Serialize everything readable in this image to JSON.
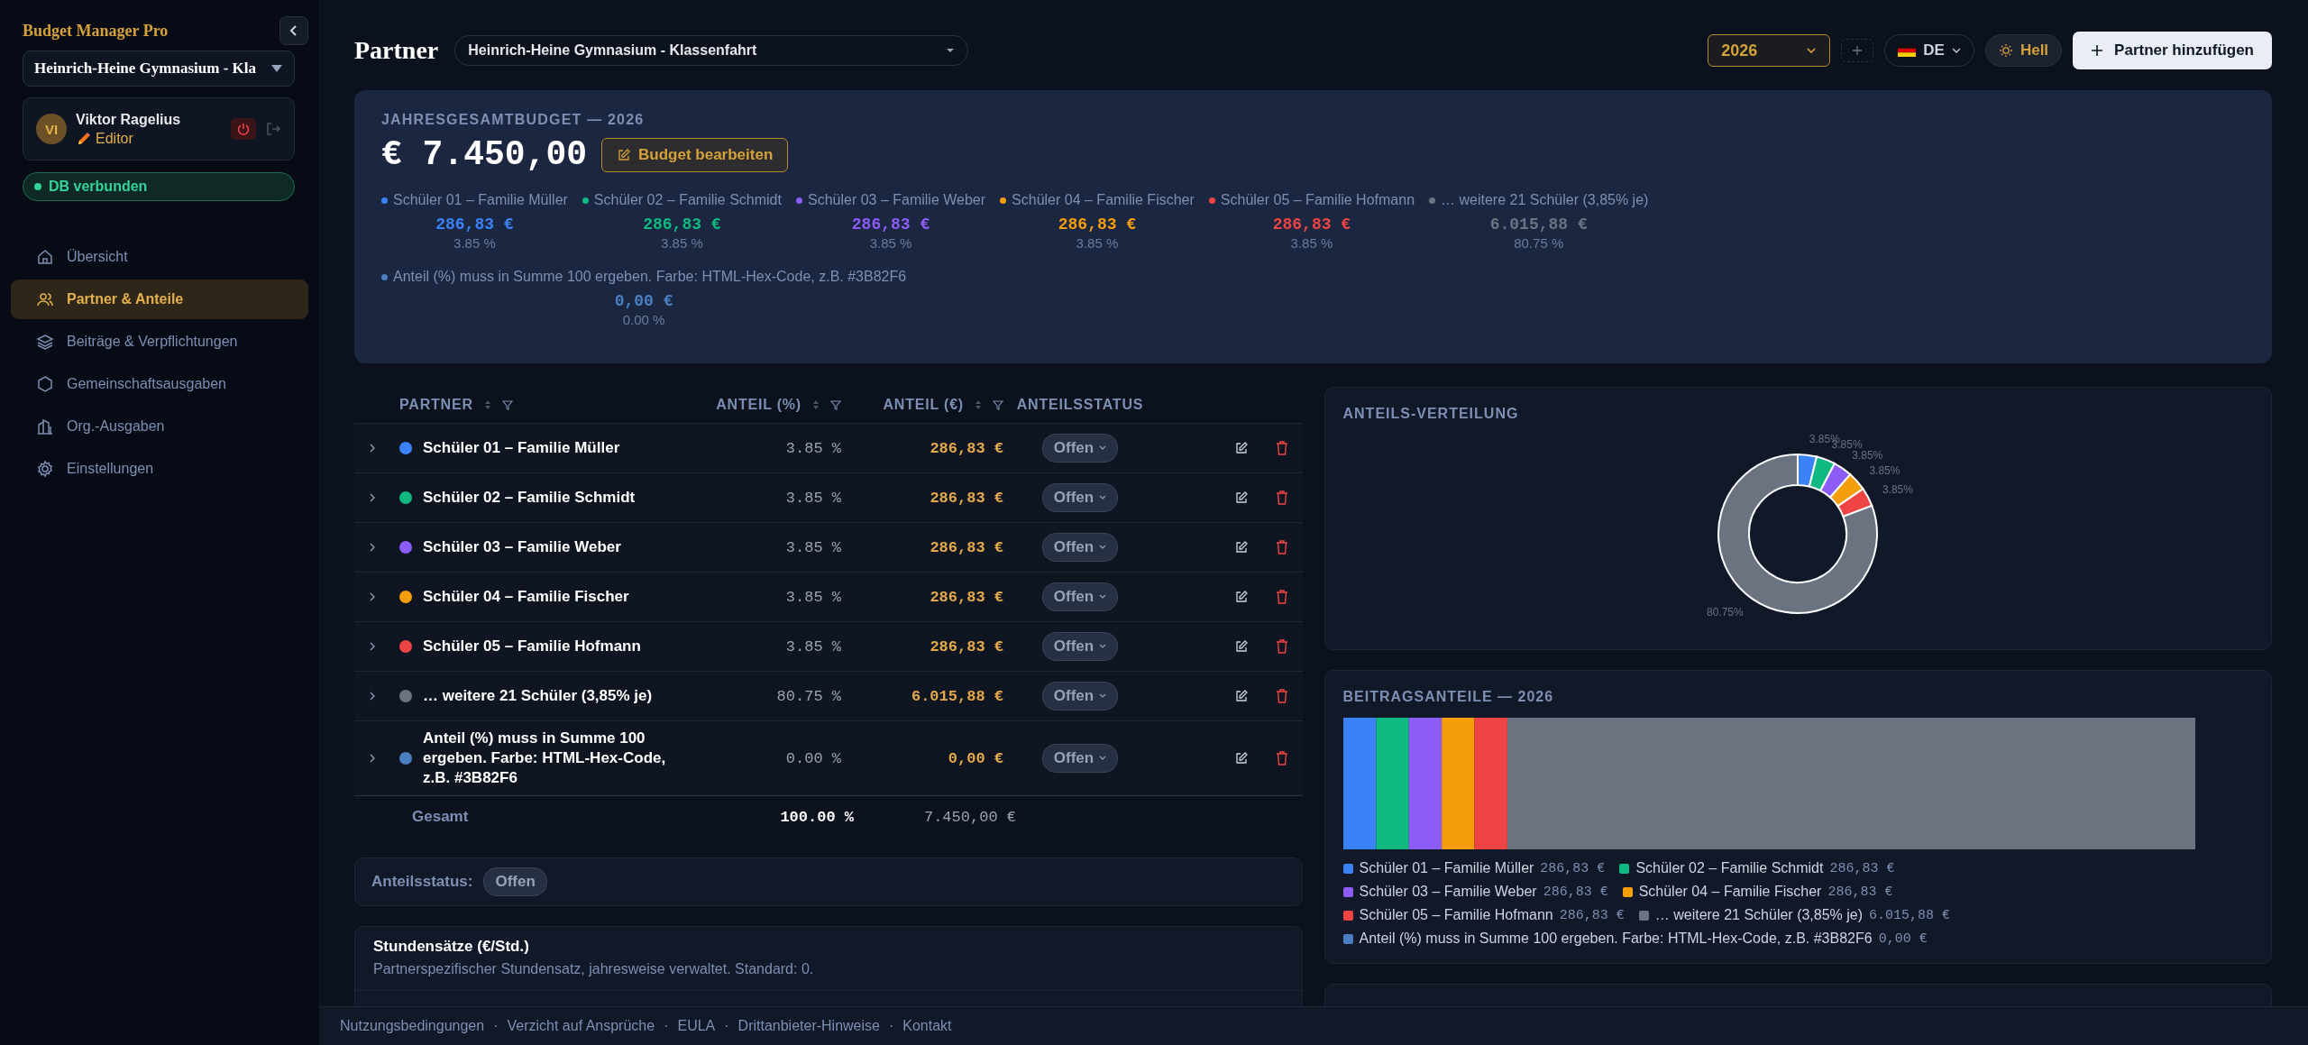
{
  "sidebar": {
    "brand": "Budget Manager Pro",
    "project": "Heinrich-Heine Gymnasium - Kla",
    "user": {
      "initials": "VI",
      "name": "Viktor Ragelius",
      "role": "Editor"
    },
    "db_status": "DB verbunden",
    "nav": [
      {
        "label": "Übersicht",
        "selected": false
      },
      {
        "label": "Partner & Anteile",
        "selected": true
      },
      {
        "label": "Beiträge & Verpflichtungen",
        "selected": false
      },
      {
        "label": "Gemeinschaftsausgaben",
        "selected": false
      },
      {
        "label": "Org.-Ausgaben",
        "selected": false
      },
      {
        "label": "Einstellungen",
        "selected": false
      }
    ]
  },
  "header": {
    "title": "Partner",
    "project": "Heinrich-Heine Gymnasium - Klassenfahrt",
    "year": "2026",
    "language": "DE",
    "theme": "Hell",
    "add_button": "Partner hinzufügen"
  },
  "budget": {
    "label": "JAHRESGESAMTBUDGET — 2026",
    "total": "€ 7.450,00",
    "edit_button": "Budget bearbeiten",
    "shares": [
      {
        "name": "Schüler 01 – Familie Müller",
        "color": "#3b82f6",
        "amount": "286,83 €",
        "percent": "3.85 %"
      },
      {
        "name": "Schüler 02 – Familie Schmidt",
        "color": "#10b981",
        "amount": "286,83 €",
        "percent": "3.85 %"
      },
      {
        "name": "Schüler 03 – Familie Weber",
        "color": "#8b5cf6",
        "amount": "286,83 €",
        "percent": "3.85 %"
      },
      {
        "name": "Schüler 04 – Familie Fischer",
        "color": "#f59e0b",
        "amount": "286,83 €",
        "percent": "3.85 %"
      },
      {
        "name": "Schüler 05 – Familie Hofmann",
        "color": "#ef4444",
        "amount": "286,83 €",
        "percent": "3.85 %"
      },
      {
        "name": "… weitere 21 Schüler (3,85% je)",
        "color": "#6b7280",
        "amount": "6.015,88 €",
        "percent": "80.75 %"
      },
      {
        "name": "Anteil (%) muss in Summe 100 ergeben. Farbe: HTML-Hex-Code, z.B. #3B82F6",
        "color": "#4a7fc1",
        "amount": "0,00 €",
        "percent": "0.00 %"
      }
    ]
  },
  "table": {
    "columns": [
      {
        "label": "PARTNER",
        "sortable": true,
        "filterable": true
      },
      {
        "label": "ANTEIL (%)",
        "sortable": true,
        "filterable": true
      },
      {
        "label": "ANTEIL (€)",
        "sortable": true,
        "filterable": true
      },
      {
        "label": "ANTEILSSTATUS",
        "sortable": false,
        "filterable": false
      }
    ],
    "rows": [
      {
        "name": "Schüler 01 – Familie Müller",
        "color": "#3b82f6",
        "percent": "3.85 %",
        "amount": "286,83 €",
        "status": "Offen"
      },
      {
        "name": "Schüler 02 – Familie Schmidt",
        "color": "#10b981",
        "percent": "3.85 %",
        "amount": "286,83 €",
        "status": "Offen"
      },
      {
        "name": "Schüler 03 – Familie Weber",
        "color": "#8b5cf6",
        "percent": "3.85 %",
        "amount": "286,83 €",
        "status": "Offen"
      },
      {
        "name": "Schüler 04 – Familie Fischer",
        "color": "#f59e0b",
        "percent": "3.85 %",
        "amount": "286,83 €",
        "status": "Offen"
      },
      {
        "name": "Schüler 05 – Familie Hofmann",
        "color": "#ef4444",
        "percent": "3.85 %",
        "amount": "286,83 €",
        "status": "Offen"
      },
      {
        "name": "… weitere 21 Schüler (3,85% je)",
        "color": "#6b7280",
        "percent": "80.75 %",
        "amount": "6.015,88 €",
        "status": "Offen"
      },
      {
        "name": "Anteil (%) muss in Summe 100 ergeben. Farbe: HTML-Hex-Code, z.B. #3B82F6",
        "color": "#4a7fc1",
        "percent": "0.00 %",
        "amount": "0,00 €",
        "status": "Offen"
      }
    ],
    "total": {
      "label": "Gesamt",
      "percent": "100.00 %",
      "amount": "7.450,00 €"
    }
  },
  "status_summary": {
    "label": "Anteilsstatus:",
    "value": "Offen"
  },
  "hourly_rates": {
    "title": "Stundensätze (€/Std.)",
    "description": "Partnerspezifischer Stundensatz, jahresweise verwaltet. Standard: 0."
  },
  "distribution": {
    "title": "ANTEILS-VERTEILUNG",
    "chart_data": {
      "type": "donut",
      "colors": [
        "#3b82f6",
        "#10b981",
        "#8b5cf6",
        "#f59e0b",
        "#ef4444",
        "#6b7280"
      ],
      "values": [
        3.85,
        3.85,
        3.85,
        3.85,
        3.85,
        80.75
      ],
      "value_labels": [
        "3.85%",
        "3.85%",
        "3.85%",
        "3.85%",
        "3.85%",
        "80.75%"
      ]
    }
  },
  "contributions": {
    "title": "BEITRAGSANTEILE — 2026",
    "items": [
      {
        "name": "Schüler 01 – Familie Müller",
        "color": "#3b82f6",
        "amount": "286,83 €"
      },
      {
        "name": "Schüler 02 – Familie Schmidt",
        "color": "#10b981",
        "amount": "286,83 €"
      },
      {
        "name": "Schüler 03 – Familie Weber",
        "color": "#8b5cf6",
        "amount": "286,83 €"
      },
      {
        "name": "Schüler 04 – Familie Fischer",
        "color": "#f59e0b",
        "amount": "286,83 €"
      },
      {
        "name": "Schüler 05 – Familie Hofmann",
        "color": "#ef4444",
        "amount": "286,83 €"
      },
      {
        "name": "… weitere 21 Schüler (3,85% je)",
        "color": "#6b7280",
        "amount": "6.015,88 €"
      },
      {
        "name": "Anteil (%) muss in Summe 100 ergeben. Farbe: HTML-Hex-Code, z.B. #3B82F6",
        "color": "#4a7fc1",
        "amount": "0,00 €"
      }
    ]
  },
  "footer": {
    "separator": "·",
    "links": [
      "Nutzungsbedingungen",
      "Verzicht auf Ansprüche",
      "EULA",
      "Drittanbieter-Hinweise",
      "Kontakt"
    ]
  }
}
